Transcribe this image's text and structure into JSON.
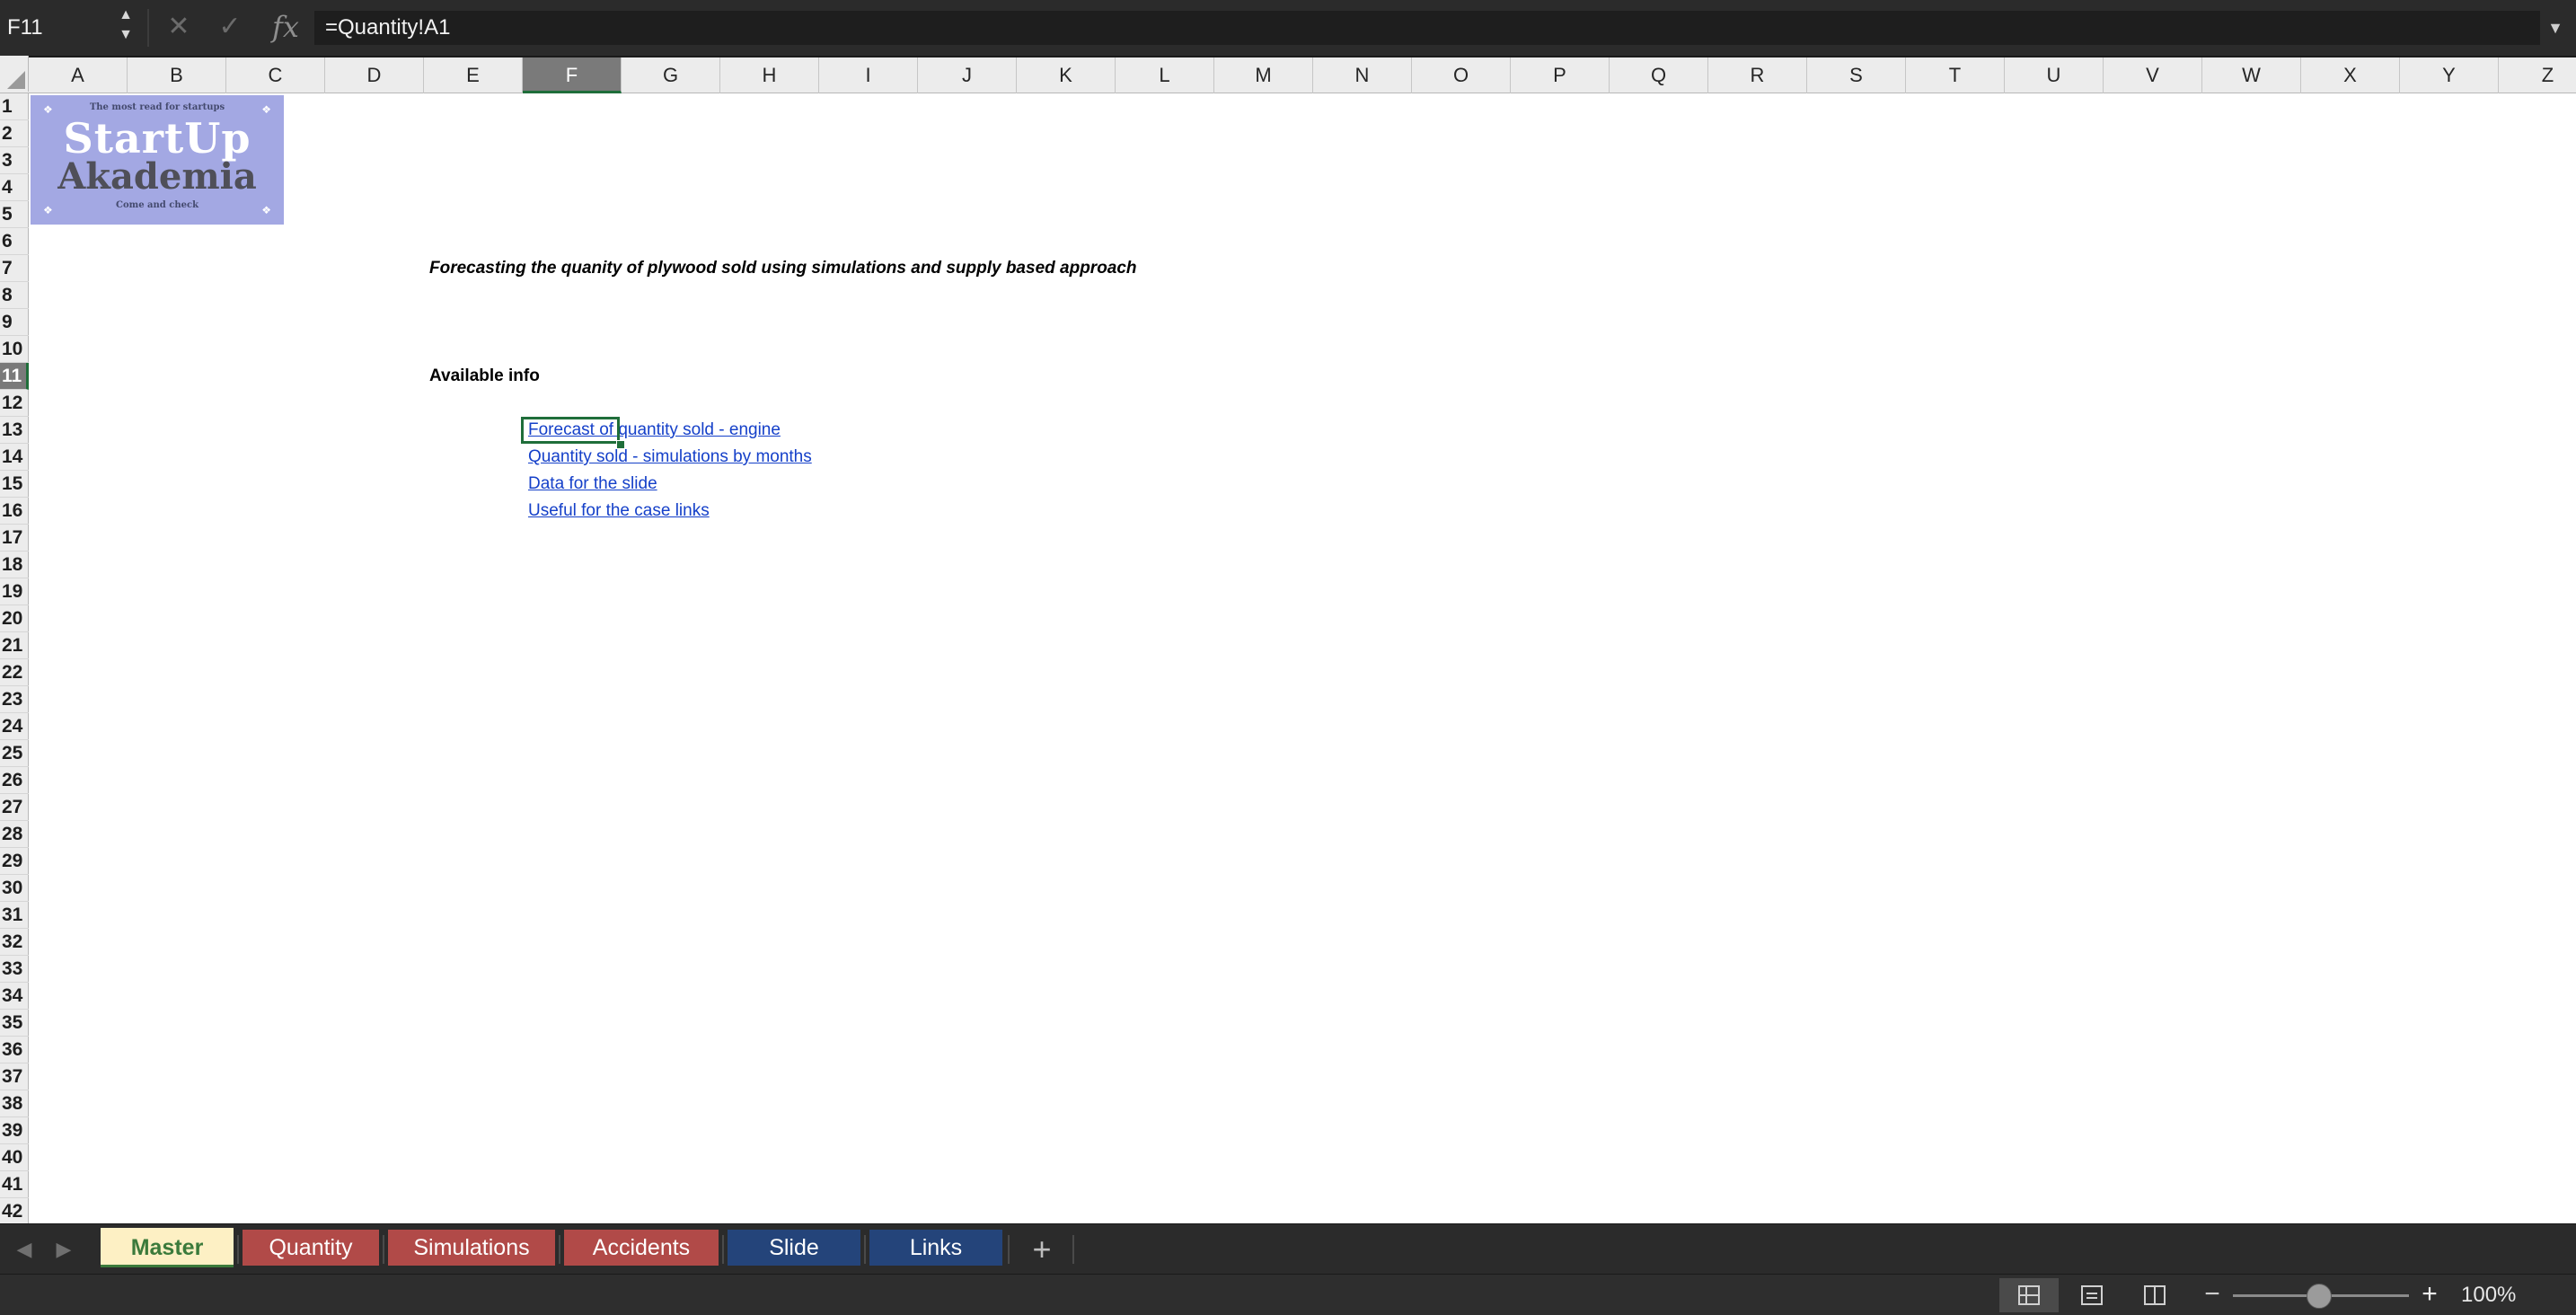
{
  "formula_bar": {
    "name_box": "F11",
    "formula": "=Quantity!A1"
  },
  "grid": {
    "columns": [
      "A",
      "B",
      "C",
      "D",
      "E",
      "F",
      "G",
      "H",
      "I",
      "J",
      "K",
      "L",
      "M",
      "N",
      "O",
      "P",
      "Q",
      "R",
      "S",
      "T",
      "U",
      "V",
      "W",
      "X",
      "Y",
      "Z"
    ],
    "active_column": "F",
    "rows": [
      "1",
      "2",
      "3",
      "4",
      "5",
      "6",
      "7",
      "8",
      "9",
      "10",
      "11",
      "12",
      "13",
      "14",
      "15",
      "16",
      "17",
      "18",
      "19",
      "20",
      "21",
      "22",
      "23",
      "24",
      "25",
      "26",
      "27",
      "28",
      "29",
      "30",
      "31",
      "32",
      "33",
      "34",
      "35",
      "36",
      "37",
      "38",
      "39",
      "40",
      "41",
      "42"
    ],
    "active_row": "11"
  },
  "logo": {
    "tagline": "The most read for startups",
    "line1": "StartUp",
    "line2": "Akademia",
    "bottom": "Come and check",
    "background_color": "#a3a8e3"
  },
  "content": {
    "title": "Forecasting the quanity of plywood sold using simulations and supply based approach",
    "available_info": "Available info",
    "links": [
      "Forecast of quantity sold - engine",
      "Quantity sold - simulations by months",
      "Data for the slide",
      "Useful for the case links"
    ],
    "link_color": "#1540c9"
  },
  "sheets": {
    "tabs": [
      {
        "label": "Master",
        "color": "#fdf0c4",
        "active": true
      },
      {
        "label": "Quantity",
        "color": "#b14a48"
      },
      {
        "label": "Simulations",
        "color": "#b14a48"
      },
      {
        "label": "Accidents",
        "color": "#b14a48"
      },
      {
        "label": "Slide",
        "color": "#24447a"
      },
      {
        "label": "Links",
        "color": "#24447a"
      }
    ],
    "add_label": "+"
  },
  "status_bar": {
    "zoom": "100%",
    "zoom_minus": "−",
    "zoom_plus": "+",
    "active_view": "normal"
  },
  "icons": {
    "cancel": "x-icon",
    "enter": "check-icon",
    "function": "fx-icon"
  }
}
